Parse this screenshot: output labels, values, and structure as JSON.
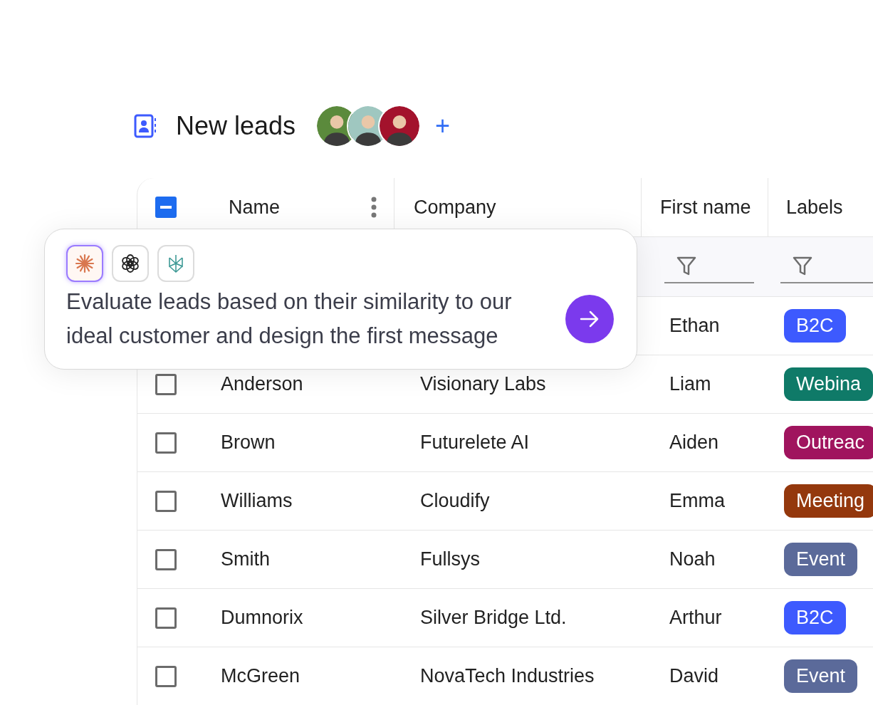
{
  "header": {
    "title": "New leads",
    "avatars": [
      {
        "color": "#5b8a3c"
      },
      {
        "color": "#9fc7c0"
      },
      {
        "color": "#a3122c"
      }
    ],
    "add_button": "+"
  },
  "table": {
    "select_all": {
      "indeterminate": true
    },
    "columns": [
      {
        "label": "Name",
        "menu": true,
        "filter": false
      },
      {
        "label": "Company",
        "menu": false,
        "filter": false
      },
      {
        "label": "First name",
        "menu": false,
        "filter": true
      },
      {
        "label": "Labels",
        "menu": false,
        "filter": true
      }
    ],
    "rows": [
      {
        "first_name": "Ethan",
        "label": {
          "text": "B2C",
          "color": "#3d5afe"
        }
      },
      {
        "checked": false,
        "last_name": "Anderson",
        "company": "Visionary Labs",
        "first_name": "Liam",
        "label": {
          "text": "Webina",
          "color": "#0f7a68"
        }
      },
      {
        "checked": false,
        "last_name": "Brown",
        "company": "Futurelete AI",
        "first_name": "Aiden",
        "label": {
          "text": "Outreac",
          "color": "#a0145e"
        }
      },
      {
        "checked": false,
        "last_name": "Williams",
        "company": "Cloudify",
        "first_name": "Emma",
        "label": {
          "text": "Meeting",
          "color": "#94380d"
        }
      },
      {
        "checked": false,
        "last_name": "Smith",
        "company": "Fullsys",
        "first_name": "Noah",
        "label": {
          "text": "Event",
          "color": "#5b6a9a"
        }
      },
      {
        "checked": false,
        "last_name": "Dumnorix",
        "company": "Silver Bridge Ltd.",
        "first_name": "Arthur",
        "label": {
          "text": "B2C",
          "color": "#3d5afe"
        }
      },
      {
        "checked": false,
        "last_name": "McGreen",
        "company": "NovaTech Industries",
        "first_name": "David",
        "label": {
          "text": "Event",
          "color": "#5b6a9a"
        }
      }
    ]
  },
  "prompt": {
    "models": [
      {
        "kind": "starburst",
        "selected": true
      },
      {
        "kind": "knot",
        "selected": false
      },
      {
        "kind": "wings",
        "selected": false
      }
    ],
    "text": "Evaluate leads based on their similarity to our ideal customer and design the first message"
  }
}
